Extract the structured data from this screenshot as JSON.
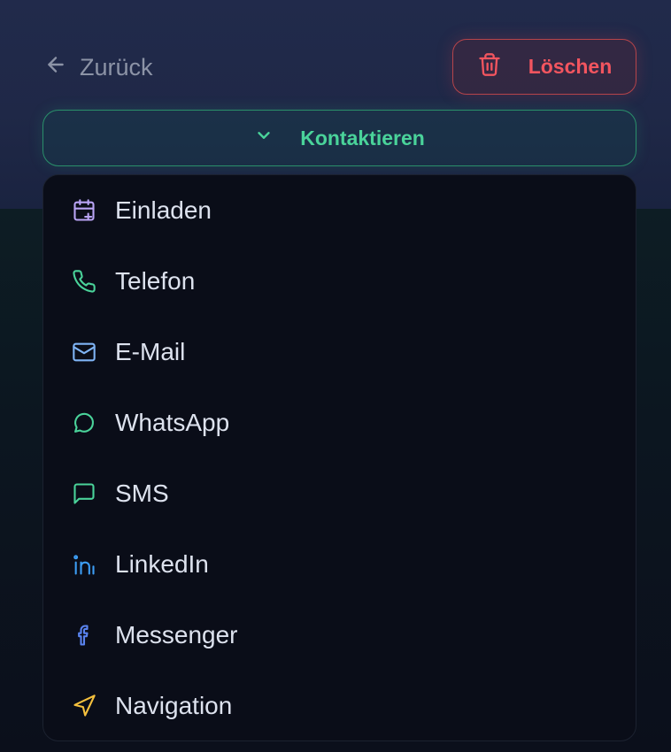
{
  "header": {
    "back_label": "Zurück",
    "delete_label": "Löschen"
  },
  "contact": {
    "button_label": "Kontaktieren",
    "items": [
      {
        "label": "Einladen",
        "icon": "calendar-plus-icon",
        "color": "#b9a4f5"
      },
      {
        "label": "Telefon",
        "icon": "phone-icon",
        "color": "#4ad39a"
      },
      {
        "label": "E-Mail",
        "icon": "mail-icon",
        "color": "#7fb4f5"
      },
      {
        "label": "WhatsApp",
        "icon": "whatsapp-icon",
        "color": "#4ad39a"
      },
      {
        "label": "SMS",
        "icon": "message-square-icon",
        "color": "#4ad39a"
      },
      {
        "label": "LinkedIn",
        "icon": "linkedin-icon",
        "color": "#3d9ef5"
      },
      {
        "label": "Messenger",
        "icon": "facebook-icon",
        "color": "#5a84f0"
      },
      {
        "label": "Navigation",
        "icon": "navigation-icon",
        "color": "#f5c03d"
      }
    ]
  },
  "colors": {
    "danger": "#f2555f",
    "accent_green": "#4ad39a",
    "menu_bg": "#0a0d18"
  }
}
